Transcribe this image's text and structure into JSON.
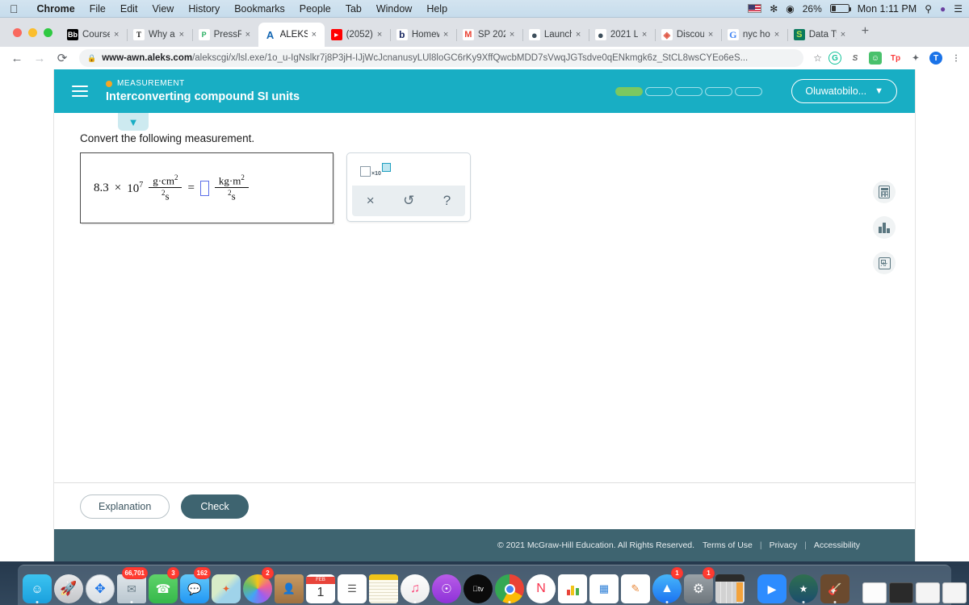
{
  "os": {
    "menubar": {
      "apple": "",
      "items": [
        "Chrome",
        "File",
        "Edit",
        "View",
        "History",
        "Bookmarks",
        "People",
        "Tab",
        "Window",
        "Help"
      ],
      "battery_percent": "26%",
      "clock": "Mon 1:11 PM",
      "search_icon": "search-icon",
      "siri_icon": "siri-icon",
      "control_center_icon": "control-center-icon"
    },
    "dock": {
      "items": [
        {
          "name": "finder",
          "badge": ""
        },
        {
          "name": "launchpad",
          "badge": ""
        },
        {
          "name": "safari",
          "badge": ""
        },
        {
          "name": "mail",
          "badge": "66,701"
        },
        {
          "name": "facetime",
          "badge": "3"
        },
        {
          "name": "messages",
          "badge": "162"
        },
        {
          "name": "maps",
          "badge": ""
        },
        {
          "name": "photos",
          "badge": "2"
        },
        {
          "name": "contacts",
          "badge": ""
        },
        {
          "name": "calendar",
          "badge": "",
          "month": "FEB",
          "day": "1"
        },
        {
          "name": "reminders",
          "badge": ""
        },
        {
          "name": "notes",
          "badge": ""
        },
        {
          "name": "music",
          "badge": ""
        },
        {
          "name": "podcasts",
          "badge": ""
        },
        {
          "name": "apple-tv",
          "badge": ""
        },
        {
          "name": "chrome",
          "badge": ""
        },
        {
          "name": "news",
          "badge": ""
        },
        {
          "name": "numbers",
          "badge": ""
        },
        {
          "name": "keynote",
          "badge": ""
        },
        {
          "name": "pages",
          "badge": ""
        },
        {
          "name": "app-store",
          "badge": "1"
        },
        {
          "name": "system-preferences",
          "badge": "1"
        },
        {
          "name": "calculator",
          "badge": ""
        },
        {
          "name": "zoom",
          "badge": ""
        },
        {
          "name": "imovie",
          "badge": ""
        },
        {
          "name": "garageband",
          "badge": ""
        },
        {
          "name": "minimized-window-1",
          "badge": ""
        },
        {
          "name": "minimized-window-2",
          "badge": ""
        },
        {
          "name": "minimized-window-3",
          "badge": ""
        },
        {
          "name": "minimized-window-4",
          "badge": ""
        },
        {
          "name": "trash",
          "badge": ""
        }
      ]
    }
  },
  "browser": {
    "tabs": [
      {
        "title": "Course",
        "fav": "Bb",
        "active": false
      },
      {
        "title": "Why a ",
        "fav": "T",
        "active": false
      },
      {
        "title": "PressR",
        "fav": "P",
        "active": false
      },
      {
        "title": "ALEKS",
        "fav": "A",
        "active": true
      },
      {
        "title": "(2052)",
        "fav": "▶",
        "active": false
      },
      {
        "title": "Homew",
        "fav": "b",
        "active": false
      },
      {
        "title": "SP 202",
        "fav": "M",
        "active": false
      },
      {
        "title": "Launch",
        "fav": "●",
        "active": false
      },
      {
        "title": "2021 L",
        "fav": "●",
        "active": false
      },
      {
        "title": "Discou",
        "fav": "◈",
        "active": false
      },
      {
        "title": "nyc ho",
        "fav": "G",
        "active": false
      },
      {
        "title": "Data Ty",
        "fav": "S",
        "active": false
      }
    ],
    "tab_close_label": "×",
    "new_tab_label": "+",
    "back_label": "←",
    "forward_label": "→",
    "reload_label": "⟳",
    "lock_icon": "lock-icon",
    "url_domain": "www-awn.aleks.com",
    "url_path": "/alekscgi/x/lsl.exe/1o_u-IgNslkr7j8P3jH-IJjWcJcnanusyLUl8loGC6rKy9XffQwcbMDD7sVwqJGTsdve0qENkmgk6z_StCL8wsCYEo6eS...",
    "star_label": "☆",
    "extensions": [
      {
        "name": "grammarly-extension",
        "glyph": "G",
        "color": "#15c39a"
      },
      {
        "name": "sumo-extension",
        "glyph": "S",
        "color": "#6b6b6b"
      },
      {
        "name": "honey-extension",
        "glyph": "☺",
        "color": "#49c16c"
      },
      {
        "name": "teachers-pay-teachers-extension",
        "glyph": "Tp",
        "color": "#fa3c3c"
      },
      {
        "name": "extensions-puzzle-icon",
        "glyph": "✦",
        "color": "#5f6368"
      },
      {
        "name": "profile-avatar",
        "glyph": "T",
        "color": "#1a73e8"
      }
    ],
    "menu_label": "⋮"
  },
  "aleks": {
    "header": {
      "menu_icon": "hamburger-menu-icon",
      "topic": "MEASUREMENT",
      "title": "Interconverting compound SI units",
      "progress_total": 5,
      "progress_filled": 1,
      "progress_fill_color": "#7bc860",
      "user_name": "Oluwatobilo...",
      "user_chevron": "⌄"
    },
    "collapse_chevron": "⌄",
    "question": {
      "prompt": "Convert the following measurement.",
      "expression": {
        "coefficient": "8.3",
        "times": "×",
        "base": "10",
        "exponent": "7",
        "left_numerator": "g·cm",
        "left_num_exp": "2",
        "left_denominator": "s",
        "left_den_exp": "2",
        "equals": "=",
        "answer_value": "",
        "right_numerator": "kg·m",
        "right_num_exp": "2",
        "right_denominator": "s",
        "right_den_exp": "2"
      }
    },
    "toolbar": {
      "scientific_notation_button": "×10",
      "clear_label": "×",
      "undo_label": "↺",
      "help_label": "?"
    },
    "rail": [
      {
        "name": "calculator-tool",
        "label": "calculator-icon"
      },
      {
        "name": "data-tool",
        "label": "bar-chart-icon"
      },
      {
        "name": "periodic-table-tool",
        "label": "periodic-table-icon"
      }
    ],
    "actions": {
      "explanation_label": "Explanation",
      "check_label": "Check",
      "check_color": "#3e6470"
    },
    "footer": {
      "copyright": "© 2021 McGraw-Hill Education. All Rights Reserved.",
      "terms": "Terms of Use",
      "privacy": "Privacy",
      "accessibility": "Accessibility",
      "separator": "|"
    }
  }
}
